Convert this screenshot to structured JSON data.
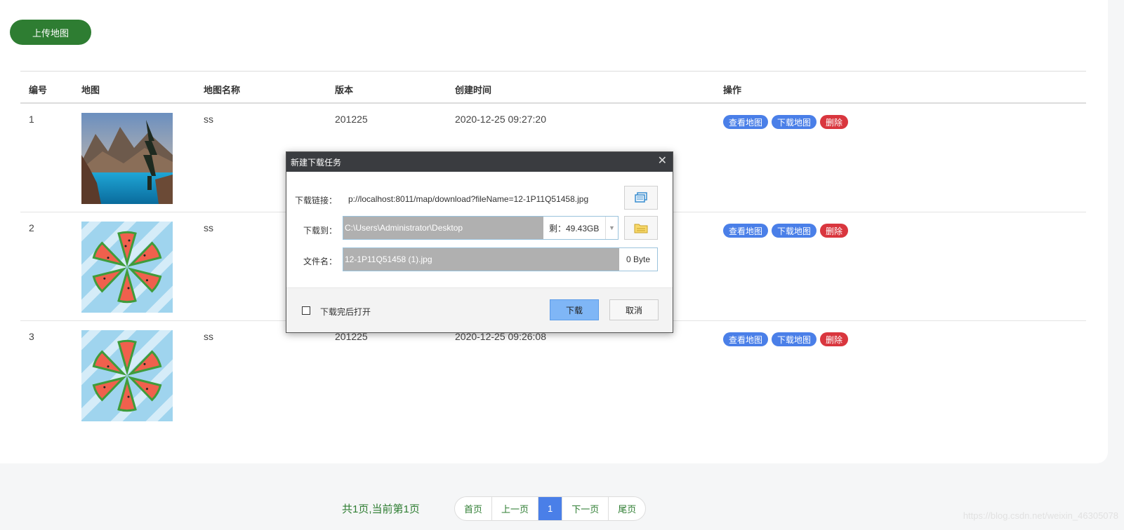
{
  "toolbar": {
    "upload_label": "上传地图"
  },
  "table": {
    "headers": [
      "编号",
      "地图",
      "地图名称",
      "版本",
      "创建时间",
      "操作"
    ],
    "rows": [
      {
        "id": "1",
        "name": "ss",
        "version": "201225",
        "created": "2020-12-25 09:27:20",
        "thumb": "mountain-lake-image"
      },
      {
        "id": "2",
        "name": "ss",
        "version": "",
        "created": "",
        "thumb": "watermelon-image"
      },
      {
        "id": "3",
        "name": "ss",
        "version": "201225",
        "created": "2020-12-25 09:26:08",
        "thumb": "watermelon-image"
      }
    ],
    "actions": {
      "view": "查看地图",
      "download": "下载地图",
      "delete": "删除"
    }
  },
  "pagination": {
    "summary": "共1页,当前第1页",
    "first": "首页",
    "prev": "上一页",
    "current": "1",
    "next": "下一页",
    "last": "尾页"
  },
  "dialog": {
    "title": "新建下载任务",
    "close": "✕",
    "url_label": "下载链接：",
    "url_value": "p://localhost:8011/map/download?fileName=12-1P11Q51458.jpg",
    "path_label": "下载到：",
    "path_value": "C:\\Users\\Administrator\\Desktop",
    "free_space": "剩：49.43GB",
    "filename_label": "文件名：",
    "filename_value": "12-1P11Q51458 (1).jpg",
    "file_size": "0 Byte",
    "open_after_label": "下载完后打开",
    "download_button": "下载",
    "cancel_button": "取消"
  },
  "watermark": "https://blog.csdn.net/weixin_46305078",
  "colors": {
    "accent_green": "#2e7d32",
    "tag_blue": "#4a7fe8",
    "tag_red": "#d9363e",
    "dialog_title": "#3a3c40"
  }
}
